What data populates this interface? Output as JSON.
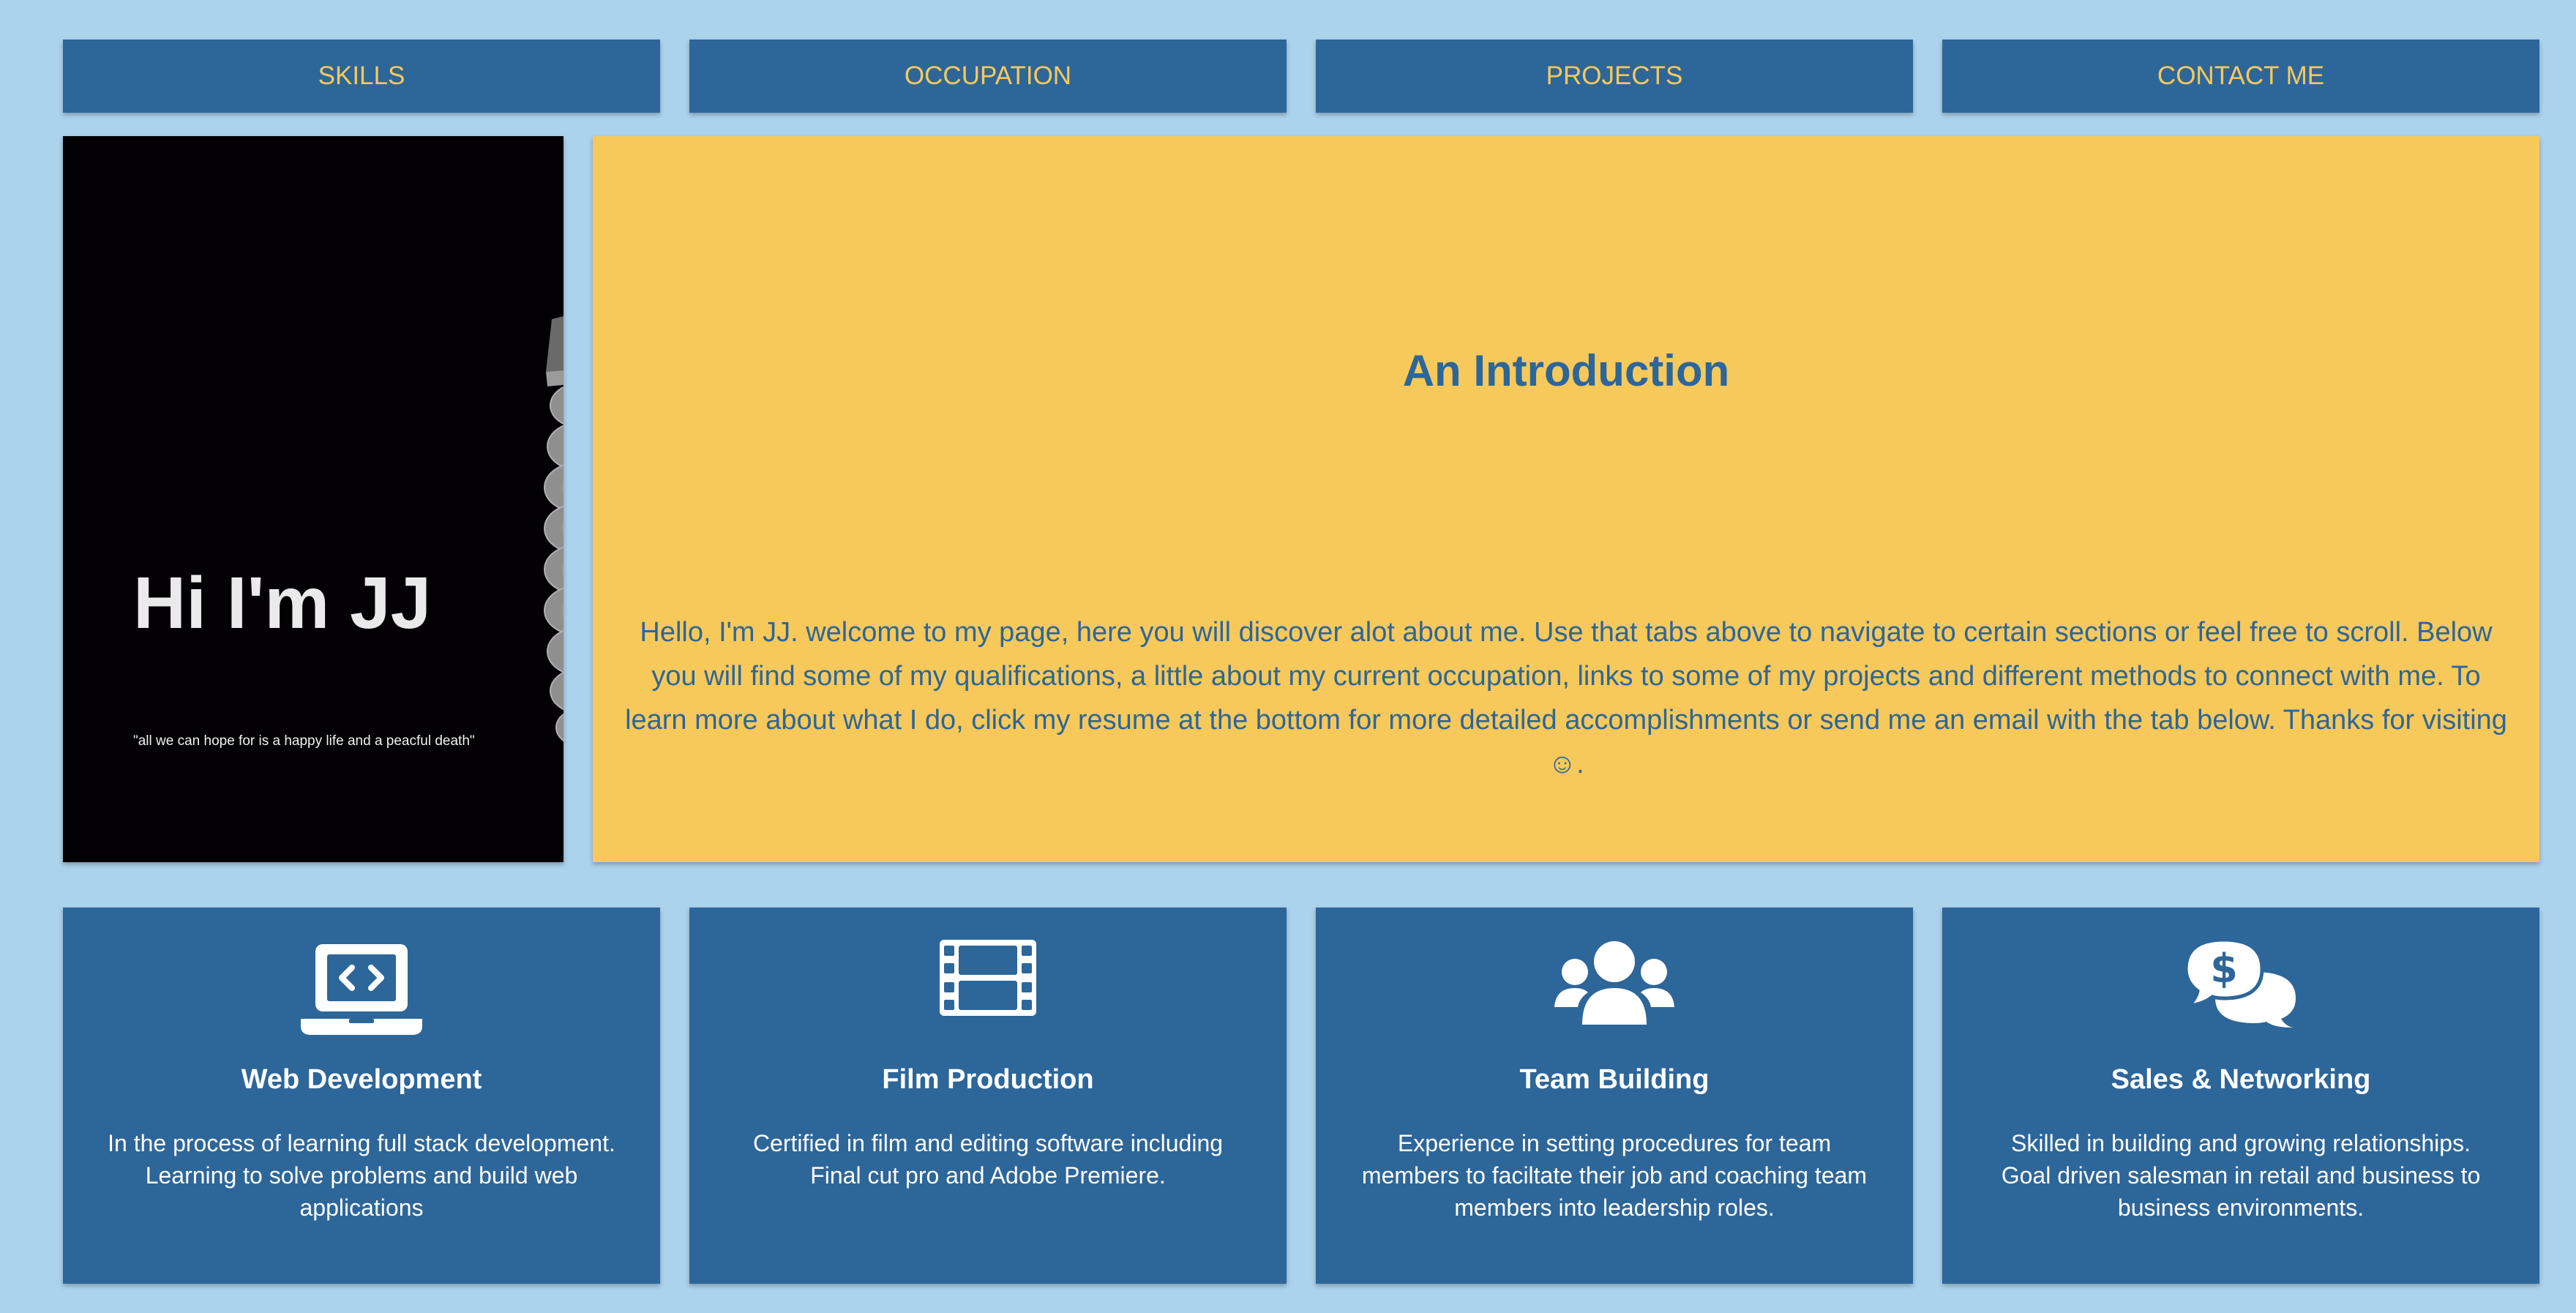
{
  "nav": {
    "tabs": [
      {
        "label": "SKILLS"
      },
      {
        "label": "OCCUPATION"
      },
      {
        "label": "PROJECTS"
      },
      {
        "label": "CONTACT ME"
      }
    ]
  },
  "hero": {
    "title": "Hi I'm JJ",
    "quote": "\"all we can hope for is a happy life and a peacful death\""
  },
  "intro": {
    "title": "An Introduction",
    "text": "Hello, I'm JJ. welcome to my page, here you will discover alot about me. Use that tabs above to navigate to certain sections or feel free to scroll. Below you will find some of my qualifications, a little about my current occupation, links to some of my projects and different methods to connect with me. To learn more about what I do, click my resume at the bottom for more detailed accomplishments or send me an email with the tab below. Thanks for visiting ☺."
  },
  "skills": [
    {
      "icon": "laptop-code-icon",
      "title": "Web Development",
      "text": "In the process of learning full stack development. Learning to solve problems and build web applications"
    },
    {
      "icon": "film-icon",
      "title": "Film Production",
      "text": "Certified in film and editing software including Final cut pro and Adobe Premiere."
    },
    {
      "icon": "users-icon",
      "title": "Team Building",
      "text": "Experience in setting procedures for team members to faciltate their job and coaching team members into leadership roles."
    },
    {
      "icon": "comments-dollar-icon",
      "title": "Sales & Networking",
      "text": "Skilled in building and growing relationships. Goal driven salesman in retail and business to business environments."
    }
  ],
  "colors": {
    "page_background": "#acd3ec",
    "primary_blue": "#2d6699",
    "accent_yellow": "#f7c95a",
    "tab_text": "#f6c95c"
  }
}
